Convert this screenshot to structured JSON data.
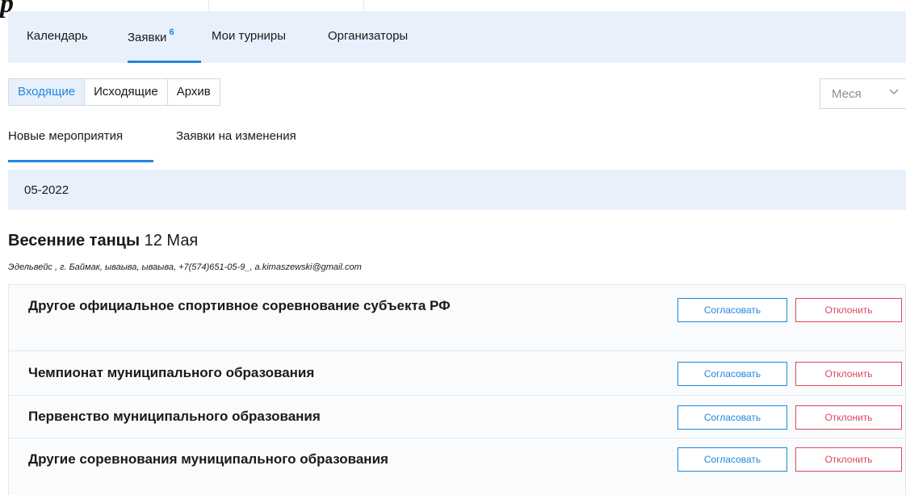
{
  "corner_glyph": "р",
  "nav": {
    "items": [
      {
        "label": "Календарь",
        "badge": ""
      },
      {
        "label": "Заявки",
        "badge": "6"
      },
      {
        "label": "Мои турниры",
        "badge": ""
      },
      {
        "label": "Организаторы",
        "badge": ""
      }
    ],
    "active_index": 1
  },
  "segments": [
    "Входящие",
    "Исходящие",
    "Архив"
  ],
  "segment_active": 0,
  "month_select": {
    "value": "Меся"
  },
  "subtabs": [
    "Новые мероприятия",
    "Заявки на изменения"
  ],
  "period": "05-2022",
  "event": {
    "name": "Весенние танцы",
    "date": "12 Мая",
    "meta": "Эдельвейс , г. Баймак, ываыва, ываыва, +7(574)651-05-9_, a.kimaszewski@gmail.com"
  },
  "requests": [
    {
      "title": "Другое официальное спортивное соревнование субъекта РФ"
    },
    {
      "title": "Чемпионат муниципального образования"
    },
    {
      "title": "Первенство муниципального образования"
    },
    {
      "title": "Другие соревнования муниципального образования"
    }
  ],
  "buttons": {
    "approve": "Согласовать",
    "reject": "Отклонить"
  },
  "colors": {
    "accent": "#1f86e0",
    "danger": "#e0465e",
    "panel": "#e8f1fb"
  }
}
